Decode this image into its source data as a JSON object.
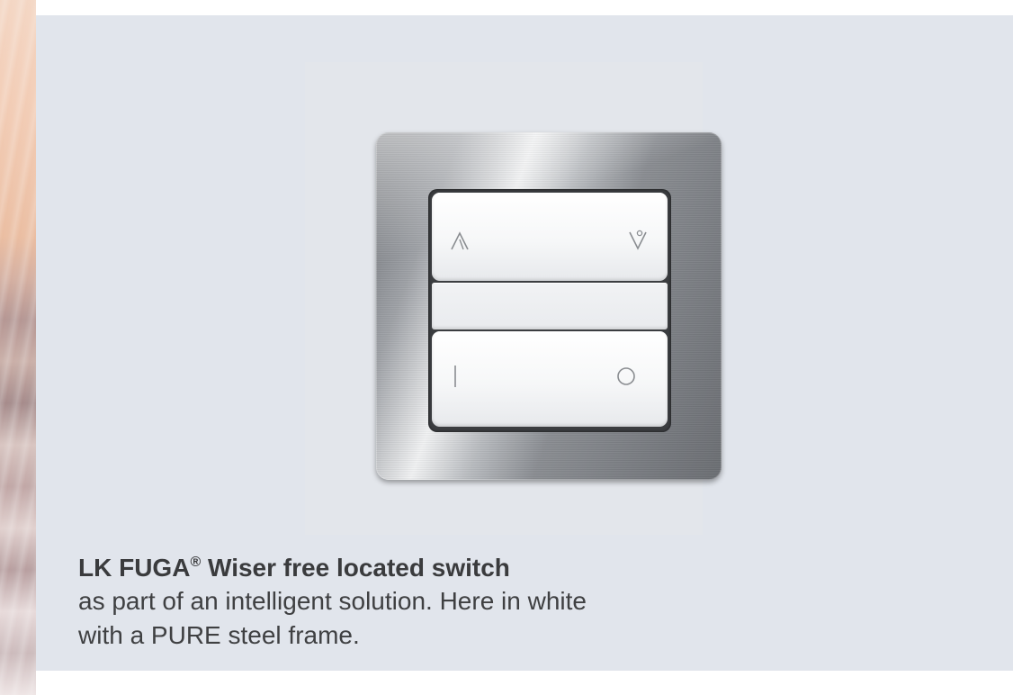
{
  "caption": {
    "title_brand": "LK FUGA",
    "title_mark": "®",
    "title_rest": " Wiser free located switch",
    "line1": "as part of an intelligent solution. Here in white",
    "line2": "with a PURE steel frame."
  },
  "switch": {
    "frame_finish": "PURE steel",
    "rocker_color": "white",
    "top_rocker_icons": [
      "up-arrow-icon",
      "down-arrow-icon"
    ],
    "bottom_rocker_icons": [
      "on-symbol-icon",
      "off-symbol-icon"
    ]
  },
  "colors": {
    "panel_background": "#e1e5ec",
    "caption_text": "#3a3b3d"
  }
}
